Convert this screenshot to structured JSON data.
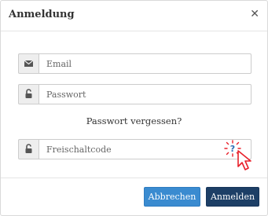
{
  "dialog": {
    "title": "Anmeldung",
    "close_icon": "close-icon"
  },
  "email": {
    "placeholder": "Email",
    "value": "",
    "icon": "envelope-icon"
  },
  "password": {
    "placeholder": "Passwort",
    "value": "",
    "icon": "unlock-icon"
  },
  "forgot_link": "Passwort vergessen?",
  "unlock_code": {
    "placeholder": "Freischaltcode",
    "value": "",
    "icon": "unlock-icon",
    "help_icon": "help-question-icon"
  },
  "buttons": {
    "cancel": "Abbrechen",
    "login": "Anmelden"
  },
  "colors": {
    "cancel_button": "#3a8bd0",
    "login_button": "#1d3f66",
    "help_highlight": "#e8202a",
    "help_question": "#2f6fb5"
  }
}
